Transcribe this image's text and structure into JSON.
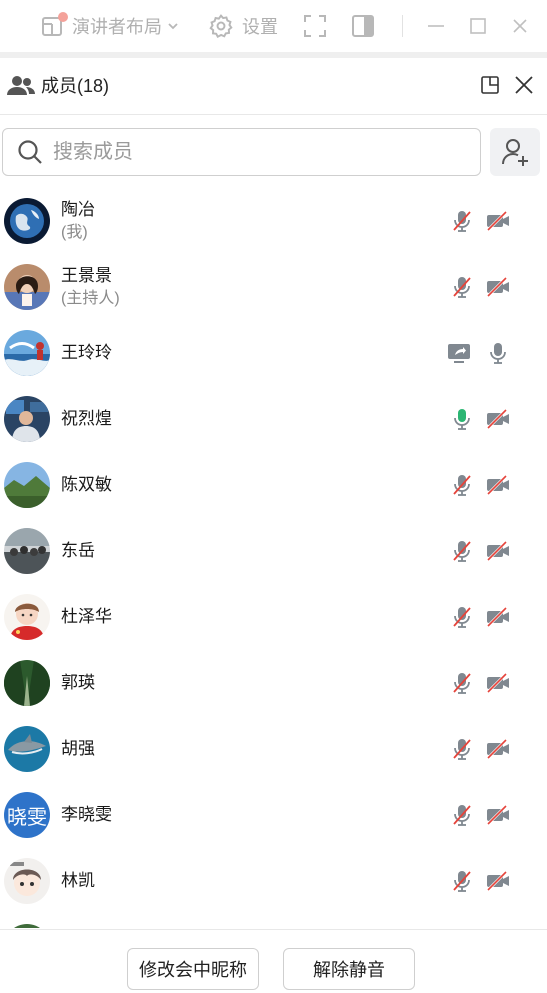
{
  "toolbar": {
    "layout_label": "演讲者布局",
    "settings_label": "设置"
  },
  "panel": {
    "title": "成员(18)"
  },
  "search": {
    "placeholder": "搜索成员"
  },
  "members": [
    {
      "name": "陶冶",
      "role": "(我)",
      "avatar": "earth",
      "mic": "muted",
      "video": "off"
    },
    {
      "name": "王景景",
      "role": "(主持人)",
      "avatar": "person-photo",
      "mic": "muted",
      "video": "off"
    },
    {
      "name": "王玲玲",
      "role": "",
      "avatar": "seaside",
      "mic": "on",
      "video": "sharing-screen"
    },
    {
      "name": "祝烈煌",
      "role": "",
      "avatar": "person-office",
      "mic": "speaking",
      "video": "off"
    },
    {
      "name": "陈双敏",
      "role": "",
      "avatar": "landscape",
      "mic": "muted",
      "video": "off"
    },
    {
      "name": "东岳",
      "role": "",
      "avatar": "group-photo",
      "mic": "muted",
      "video": "off"
    },
    {
      "name": "杜泽华",
      "role": "",
      "avatar": "cartoon-boy",
      "mic": "muted",
      "video": "off"
    },
    {
      "name": "郭瑛",
      "role": "",
      "avatar": "forest-road",
      "mic": "muted",
      "video": "off"
    },
    {
      "name": "胡强",
      "role": "",
      "avatar": "shark",
      "mic": "muted",
      "video": "off"
    },
    {
      "name": "李晓雯",
      "role": "",
      "avatar_text": "晓雯",
      "avatar": "initials",
      "mic": "muted",
      "video": "off"
    },
    {
      "name": "林凯",
      "role": "",
      "avatar": "cartoon-face",
      "mic": "muted",
      "video": "off"
    }
  ],
  "actions": {
    "rename_label": "修改会中昵称",
    "unmute_label": "解除静音"
  },
  "colors": {
    "muted_red": "#e5443b",
    "speaking_green": "#2bb673",
    "icon_gray": "#808890",
    "avatar_blue": "#2e73c9"
  }
}
